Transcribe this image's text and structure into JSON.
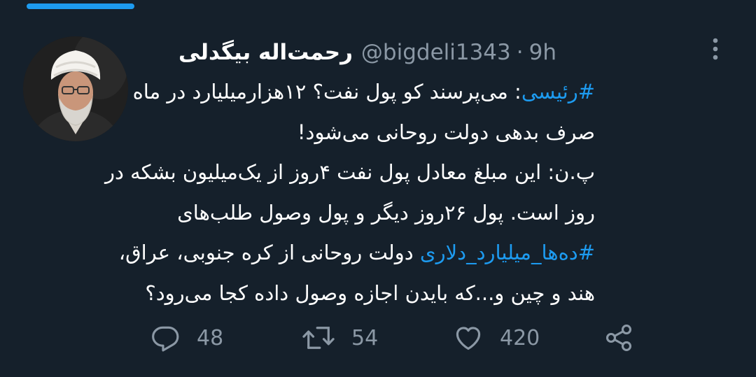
{
  "tweet": {
    "author": {
      "display_name": "رحمت‌اله بیگدلی",
      "handle": "@bigdeli1343",
      "separator": "·",
      "time": "9h"
    },
    "lines": [
      {
        "hashtag": "#رئیسی",
        "text": ": می‌پرسند کو پول نفت؟ ۱۲هزارمیلیارد در ماه"
      },
      {
        "text": "صرف بدهی دولت روحانی می‌شود!"
      },
      {
        "text": "پ.ن: این مبلغ معادل پول نفت ۴روز از یک‌میلیون بشکه در"
      },
      {
        "text": "روز است. پول ۲۶روز دیگر و پول وصول طلب‌های"
      },
      {
        "hashtag": "#ده‌ها_میلیارد_دلاری",
        "text": " دولت روحانی از کره جنوبی، عراق،"
      },
      {
        "text": "هند و چین و...که بایدن اجازه وصول داده کجا می‌رود؟"
      }
    ]
  },
  "actions": {
    "reply_count": "48",
    "retweet_count": "54",
    "like_count": "420"
  },
  "icons": {
    "more": "more-vertical-icon",
    "reply": "reply-icon",
    "retweet": "retweet-icon",
    "like": "heart-icon",
    "share": "share-icon"
  },
  "colors": {
    "background": "#15202b",
    "accent": "#1d9bf0",
    "secondary_text": "#8b98a5"
  }
}
